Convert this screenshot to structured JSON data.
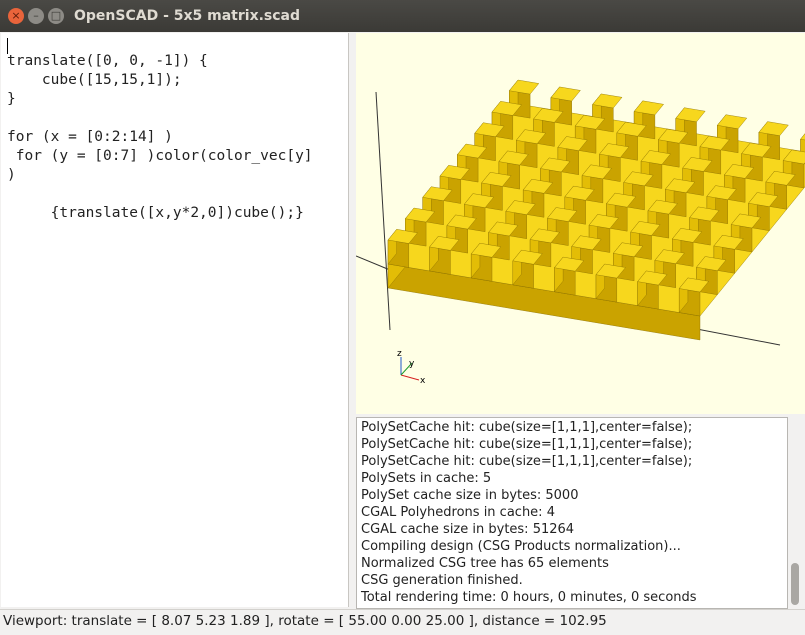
{
  "window": {
    "title": "OpenSCAD - 5x5 matrix.scad",
    "close_glyph": "×",
    "minimize_glyph": "–",
    "maximize_glyph": "□"
  },
  "editor": {
    "code": "translate([0, 0, -1]) {\n    cube([15,15,1]);\n}\n\nfor (x = [0:2:14] )\n for (y = [0:7] )color(color_vec[y]\n)\n\n     {translate([x,y*2,0])cube();}"
  },
  "viewport": {
    "base_color": "#f5d418",
    "background": "#ffffe5",
    "axis_labels": {
      "x": "x",
      "y": "y",
      "z": "z"
    }
  },
  "console": {
    "lines": [
      "PolySetCache hit: cube(size=[1,1,1],center=false);",
      "PolySetCache hit: cube(size=[1,1,1],center=false);",
      "PolySetCache hit: cube(size=[1,1,1],center=false);",
      "PolySets in cache: 5",
      "PolySet cache size in bytes: 5000",
      "CGAL Polyhedrons in cache: 4",
      "CGAL cache size in bytes: 51264",
      "Compiling design (CSG Products normalization)...",
      "Normalized CSG tree has 65 elements",
      "CSG generation finished.",
      "Total rendering time: 0 hours, 0 minutes, 0 seconds"
    ]
  },
  "statusbar": {
    "text": "Viewport: translate = [ 8.07 5.23 1.89 ], rotate = [ 55.00 0.00 25.00 ], distance = 102.95"
  }
}
